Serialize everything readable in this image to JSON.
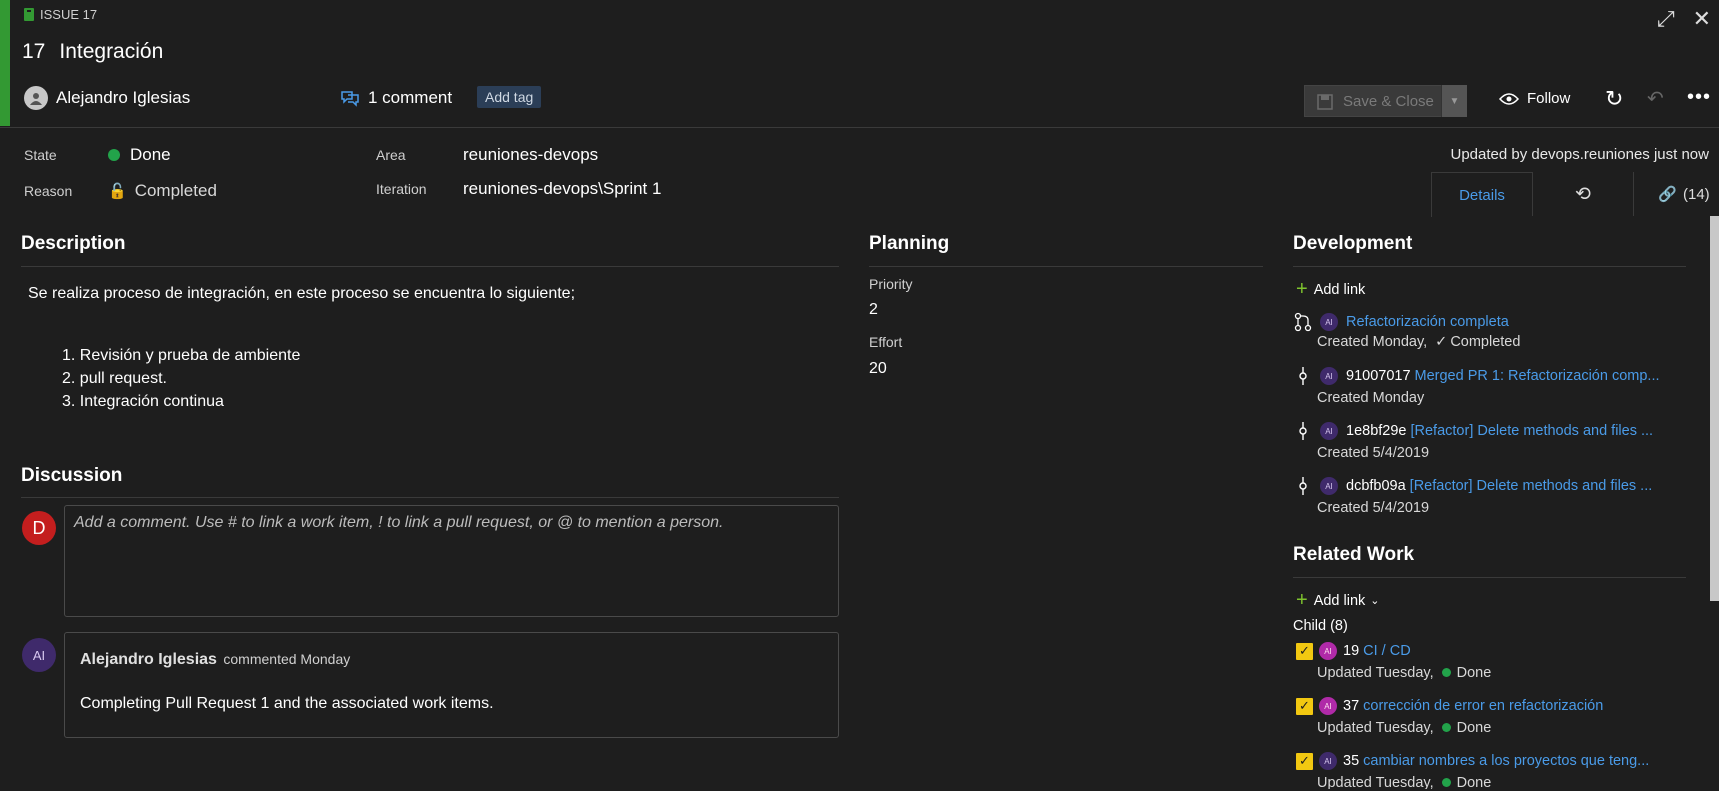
{
  "header": {
    "issue_label": "ISSUE 17",
    "id": "17",
    "title": "Integración",
    "assigned_to": "Alejandro Iglesias",
    "comment_count": "1 comment",
    "add_tag": "Add tag",
    "save_close": "Save & Close",
    "follow": "Follow"
  },
  "fields": {
    "state_label": "State",
    "state_value": "Done",
    "reason_label": "Reason",
    "reason_value": "Completed",
    "area_label": "Area",
    "area_value": "reuniones-devops",
    "iteration_label": "Iteration",
    "iteration_value": "reuniones-devops\\Sprint 1",
    "updated": "Updated by devops.reuniones just now"
  },
  "tabs": {
    "details": "Details",
    "links": "(14)"
  },
  "description": {
    "title": "Description",
    "intro": "Se realiza proceso de integración, en este proceso se encuentra lo siguiente;",
    "items": [
      "1. Revisión y prueba de ambiente",
      "2. pull request.",
      "3. Integración continua"
    ]
  },
  "discussion": {
    "title": "Discussion",
    "avatar_initial": "D",
    "placeholder": "Add a comment. Use # to link a work item, ! to link a pull request, or @ to mention a person.",
    "comment_avatar": "AI",
    "comment_author": "Alejandro Iglesias",
    "comment_meta": "commented Monday",
    "comment_text": "Completing Pull Request 1 and the associated work items."
  },
  "planning": {
    "title": "Planning",
    "priority_label": "Priority",
    "priority_value": "2",
    "effort_label": "Effort",
    "effort_value": "20"
  },
  "development": {
    "title": "Development",
    "add_link": "Add link",
    "items": [
      {
        "prefix": "",
        "link": "Refactorización completa",
        "sub": "Created Monday,",
        "status": "Completed"
      },
      {
        "prefix": "91007017",
        "link": "Merged PR 1: Refactorización comp...",
        "sub": "Created Monday"
      },
      {
        "prefix": "1e8bf29e",
        "link": "[Refactor] Delete methods and files ...",
        "sub": "Created 5/4/2019"
      },
      {
        "prefix": "dcbfb09a",
        "link": "[Refactor] Delete methods and files ...",
        "sub": "Created 5/4/2019"
      }
    ]
  },
  "related": {
    "title": "Related Work",
    "add_link": "Add link",
    "child_label": "Child (8)",
    "items": [
      {
        "id": "19",
        "link": "CI / CD",
        "sub": "Updated Tuesday,",
        "status": "Done"
      },
      {
        "id": "37",
        "link": "corrección de error en refactorización",
        "sub": "Updated Tuesday,",
        "status": "Done"
      },
      {
        "id": "35",
        "link": "cambiar nombres a los proyectos que teng...",
        "sub": "Updated Tuesday,",
        "status": "Done"
      }
    ]
  },
  "colors": {
    "accent_green": "#339933",
    "link_blue": "#4a9be8",
    "done_green": "#22a34a",
    "task_yellow": "#f2c811"
  }
}
